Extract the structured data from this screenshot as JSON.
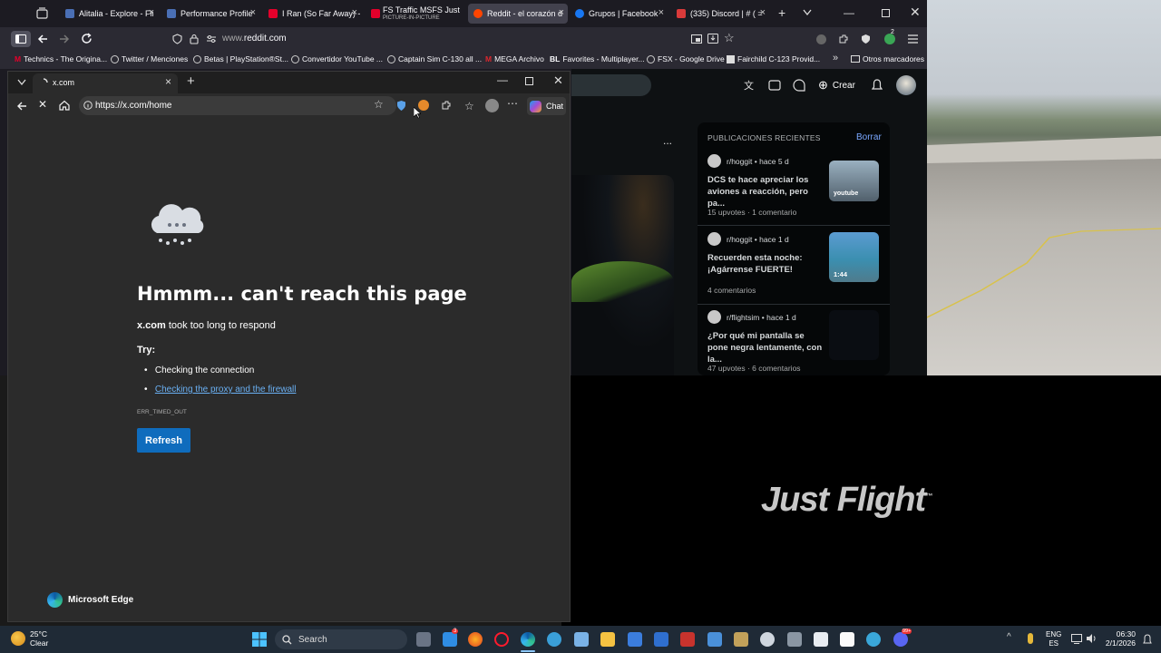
{
  "firefox": {
    "tabs": [
      {
        "label": "Alitalia - Explore - Fli",
        "color": "#4a6fb5"
      },
      {
        "label": "Performance Profile",
        "color": "#4a6fb5"
      },
      {
        "label": "I Ran (So Far Away) -",
        "color": "#e4002b"
      },
      {
        "label": "FS Traffic MSFS Just",
        "sublabel": "PICTURE-IN-PICTURE",
        "color": "#e4002b"
      },
      {
        "label": "Reddit - el corazón d",
        "color": "#ff4500"
      },
      {
        "label": "Grupos | Facebook",
        "color": "#1877f2"
      },
      {
        "label": "(335) Discord | # ( =",
        "color": "#d93a3a"
      }
    ],
    "url_prefix": "www.",
    "url_domain": "reddit.com",
    "bookmarks": [
      "Technics - The Origina...",
      "Twitter / Menciones",
      "Betas | PlayStation®St...",
      "Convertidor YouTube ...",
      "Captain Sim C-130 all ...",
      "MEGA Archivo",
      "Favorites - Multiplayer...",
      "FSX - Google Drive",
      "Fairchild C-123 Provid...",
      "Otros marcadores"
    ],
    "bookmark_mega_letter": "M",
    "bookmark_bl_letter": "BL",
    "new_tab": "+",
    "ext_badge": "2"
  },
  "reddit": {
    "create_label": "Crear",
    "recent_header": "PUBLICACIONES RECIENTES",
    "clear_label": "Borrar",
    "posts": [
      {
        "sub": "r/hoggit",
        "age": "hace 5 d",
        "title": "DCS te hace apreciar los aviones a reacción, pero pa...",
        "meta1": "15 upvotes",
        "meta2": "1 comentario",
        "thumb_label": "youtube"
      },
      {
        "sub": "r/hoggit",
        "age": "hace 1 d",
        "title": "Recuerden esta noche: ¡Agárrense FUERTE!",
        "meta1": "4 comentarios",
        "thumb_label": "1:44"
      },
      {
        "sub": "r/flightsim",
        "age": "hace 1 d",
        "title": "¿Por qué mi pantalla se pone negra lentamente, con la...",
        "meta1": "47 upvotes",
        "meta2": "6 comentarios"
      }
    ],
    "more": "...",
    "dot": "•"
  },
  "edge": {
    "tab_title": "x.com",
    "url": "https://x.com/home",
    "chat_label": "Chat",
    "error": {
      "title": "Hmmm... can't reach this page",
      "domain": "x.com",
      "subtitle_rest": " took too long to respond",
      "try_label": "Try:",
      "suggestions": [
        "Checking the connection",
        "Checking the proxy and the firewall"
      ],
      "code": "ERR_TIMED_OUT",
      "refresh_label": "Refresh"
    },
    "brand": "Microsoft Edge"
  },
  "pip": {
    "logo_text": "Just Flight",
    "tm": "™"
  },
  "taskbar": {
    "temp": "25°C",
    "weather": "Clear",
    "search_label": "Search",
    "lang1": "ENG",
    "lang2": "ES",
    "time": "06:30",
    "date": "2/1/2026",
    "badge1": "3",
    "badge2": "99+"
  }
}
